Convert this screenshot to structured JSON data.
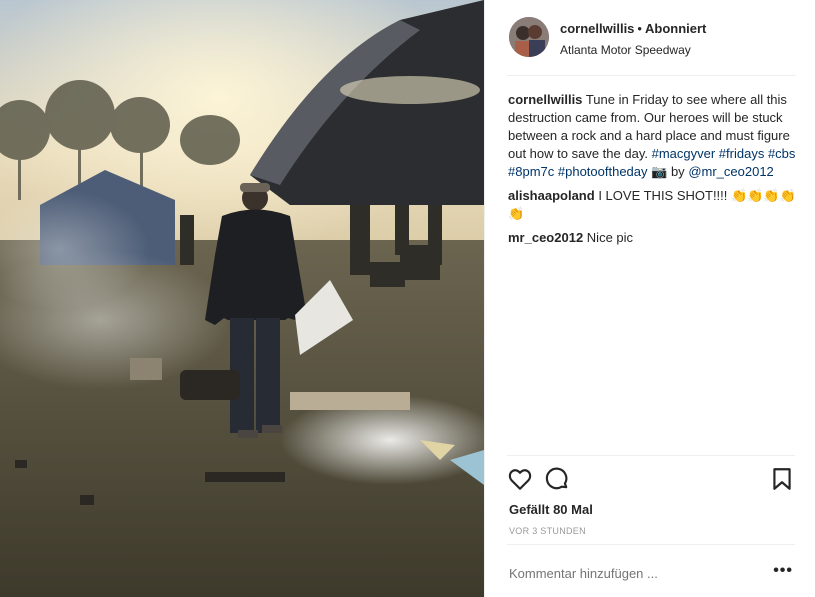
{
  "header": {
    "username": "cornellwillis",
    "separator": "•",
    "follow_status": "Abonniert",
    "location": "Atlanta Motor Speedway"
  },
  "caption": {
    "username": "cornellwillis",
    "text": "Tune in Friday to see where all this destruction came from. Our heroes will be stuck between a rock and a hard place and must figure out how to save the day.",
    "hashtags": [
      "#macgyver",
      "#fridays",
      "#cbs",
      "#8pm7c",
      "#photooftheday"
    ],
    "camera_emoji": "📷",
    "by_text": "by",
    "mention": "@mr_ceo2012"
  },
  "comments": [
    {
      "username": "alishaapoland",
      "text": "I LOVE THIS SHOT!!!! 👏👏👏👏👏"
    },
    {
      "username": "mr_ceo2012",
      "text": "Nice pic"
    }
  ],
  "actions": {
    "like_icon": "heart-icon",
    "comment_icon": "comment-bubble-icon",
    "save_icon": "bookmark-icon",
    "likes": "Gefällt 80 Mal",
    "timestamp": "VOR 3 STUNDEN"
  },
  "add_comment": {
    "placeholder": "Kommentar hinzufügen ...",
    "more_label": "•••"
  },
  "colors": {
    "text": "#262626",
    "link": "#003569",
    "muted": "#999999",
    "divider": "#efefef"
  }
}
